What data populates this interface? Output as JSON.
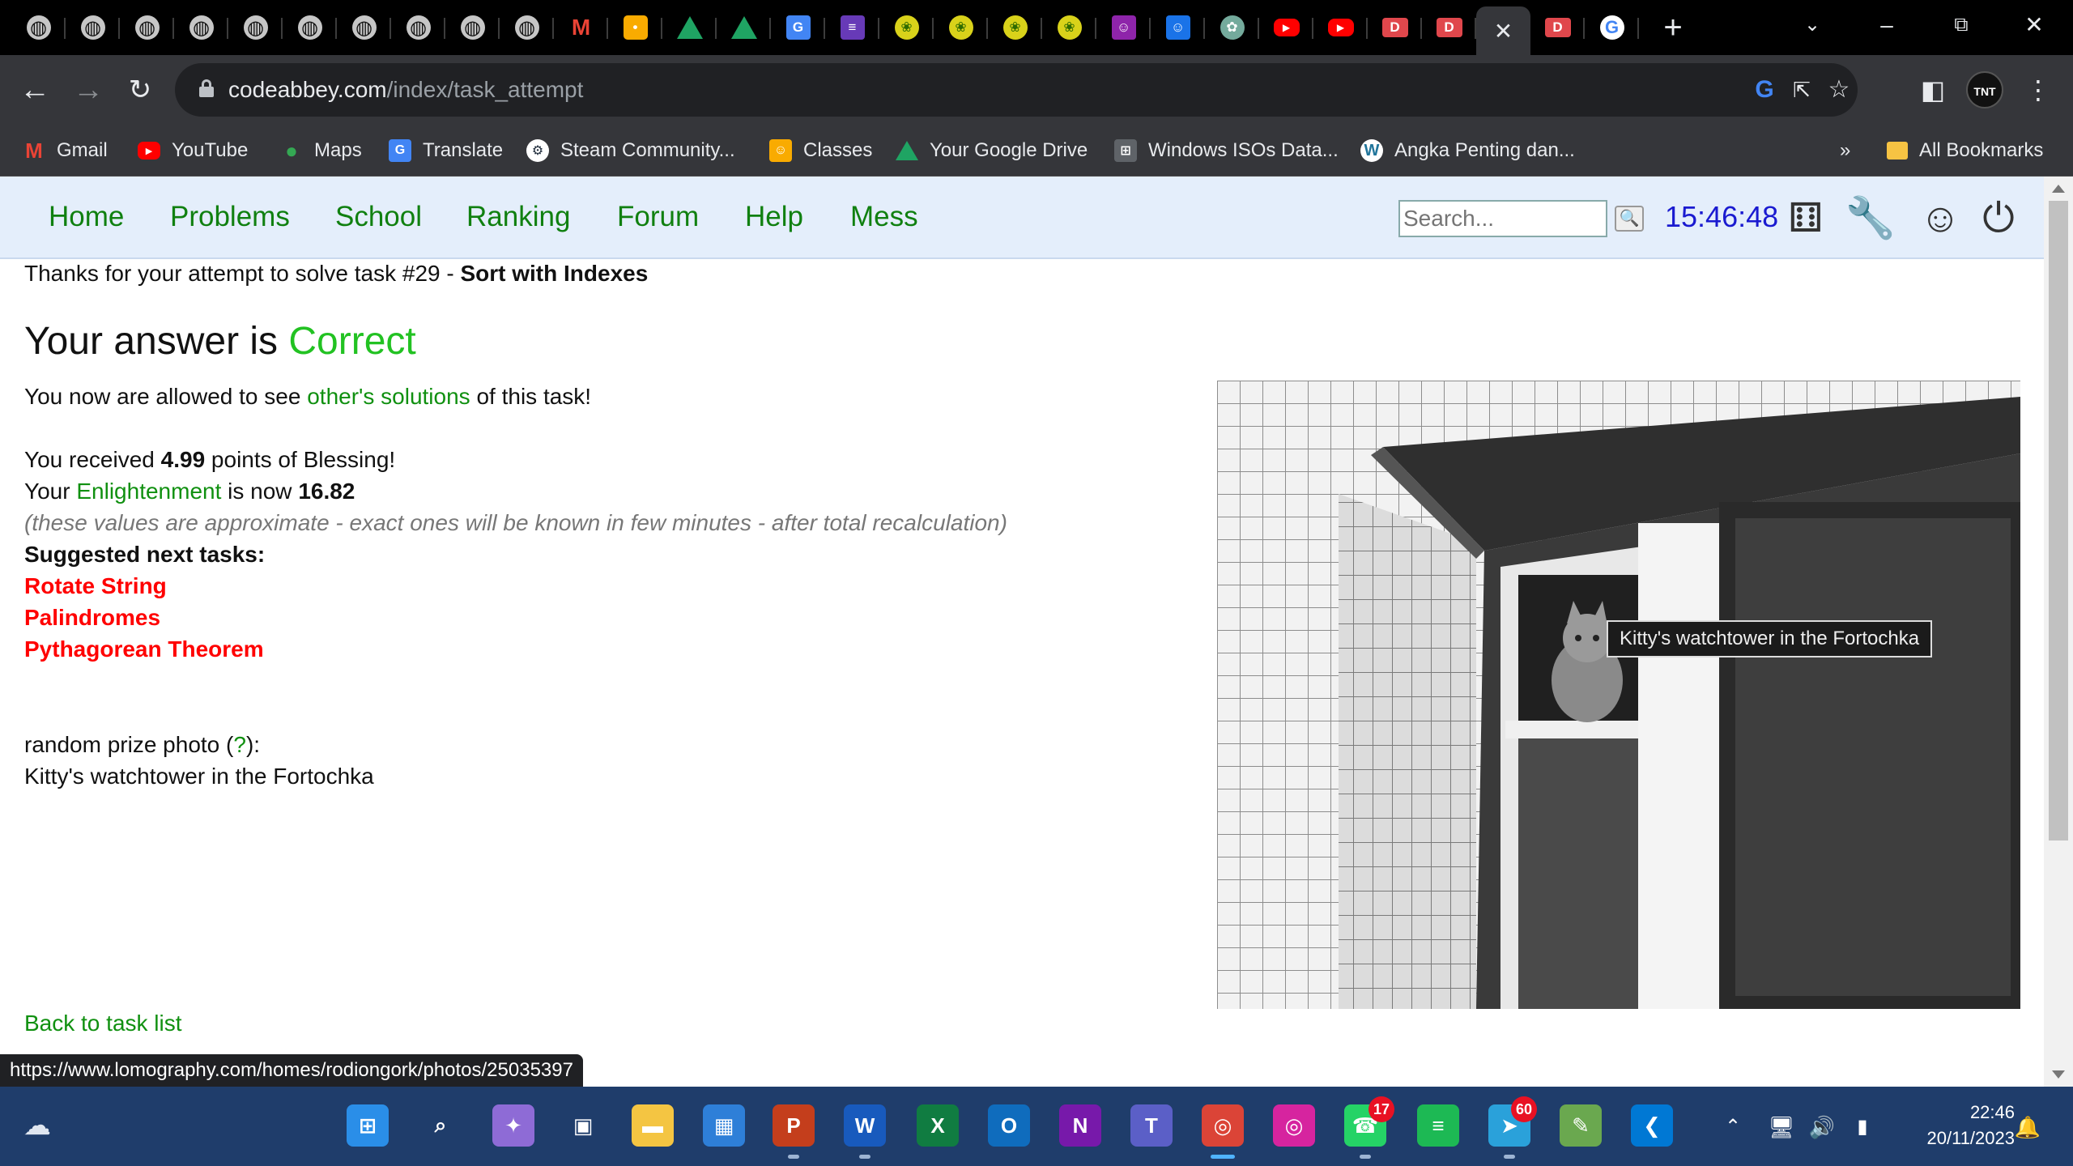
{
  "browser": {
    "tabs": [
      {
        "icon": "globe-icon",
        "glyph": "◍",
        "cls": "globe"
      },
      {
        "icon": "globe-icon",
        "glyph": "◍",
        "cls": "globe"
      },
      {
        "icon": "globe-icon",
        "glyph": "◍",
        "cls": "globe"
      },
      {
        "icon": "globe-icon",
        "glyph": "◍",
        "cls": "globe"
      },
      {
        "icon": "globe-icon",
        "glyph": "◍",
        "cls": "globe"
      },
      {
        "icon": "globe-icon",
        "glyph": "◍",
        "cls": "globe"
      },
      {
        "icon": "globe-icon",
        "glyph": "◍",
        "cls": "globe"
      },
      {
        "icon": "globe-icon",
        "glyph": "◍",
        "cls": "globe"
      },
      {
        "icon": "globe-icon",
        "glyph": "◍",
        "cls": "globe"
      },
      {
        "icon": "globe-icon",
        "glyph": "◍",
        "cls": "globe"
      },
      {
        "icon": "gmail-icon",
        "glyph": "M",
        "cls": "gmail"
      },
      {
        "icon": "google-keep-icon",
        "glyph": "•",
        "cls": "keep"
      },
      {
        "icon": "google-drive-icon",
        "glyph": "",
        "cls": "drive"
      },
      {
        "icon": "google-drive-icon",
        "glyph": "",
        "cls": "drive"
      },
      {
        "icon": "google-translate-icon",
        "glyph": "G",
        "cls": "trans"
      },
      {
        "icon": "google-forms-icon",
        "glyph": "≡",
        "cls": "forms"
      },
      {
        "icon": "school-logo-icon",
        "glyph": "❀",
        "cls": "sch"
      },
      {
        "icon": "school-logo-icon",
        "glyph": "❀",
        "cls": "sch"
      },
      {
        "icon": "school-logo-icon",
        "glyph": "❀",
        "cls": "sch"
      },
      {
        "icon": "school-logo-icon",
        "glyph": "❀",
        "cls": "sch"
      },
      {
        "icon": "google-classroom-icon",
        "glyph": "☺",
        "cls": "class"
      },
      {
        "icon": "google-classroom-icon",
        "glyph": "☺",
        "cls": "classb"
      },
      {
        "icon": "chatgpt-icon",
        "glyph": "✿",
        "cls": "gpt"
      },
      {
        "icon": "youtube-icon",
        "glyph": "▶",
        "cls": "yt"
      },
      {
        "icon": "youtube-icon",
        "glyph": "▶",
        "cls": "yt"
      },
      {
        "icon": "youtube-create-icon",
        "glyph": "D",
        "cls": "ytc"
      },
      {
        "icon": "youtube-create-icon",
        "glyph": "D",
        "cls": "ytc"
      },
      {
        "icon": "close-tab-icon",
        "glyph": "✕",
        "cls": "close",
        "active": true
      },
      {
        "icon": "youtube-create-icon",
        "glyph": "D",
        "cls": "ytc"
      },
      {
        "icon": "google-icon",
        "glyph": "G",
        "cls": "g"
      }
    ],
    "url_host": "codeabbey.com",
    "url_path": "/index/task_attempt",
    "bookmarks": [
      {
        "label": "Gmail",
        "icon": "gmail-icon",
        "glyph": "M",
        "cls": "gm"
      },
      {
        "label": "YouTube",
        "icon": "youtube-icon",
        "glyph": "▶",
        "cls": "ytb"
      },
      {
        "label": "Maps",
        "icon": "maps-pin-icon",
        "glyph": "●",
        "cls": "maps"
      },
      {
        "label": "Translate",
        "icon": "google-translate-icon",
        "glyph": "G",
        "cls": "tr"
      },
      {
        "label": "Steam Community...",
        "icon": "steam-icon",
        "glyph": "⚙",
        "cls": "st"
      },
      {
        "label": "Classes",
        "icon": "google-classroom-icon",
        "glyph": "☺",
        "cls": "cl"
      },
      {
        "label": "Your Google Drive",
        "icon": "google-drive-icon",
        "glyph": "",
        "cls": "dr"
      },
      {
        "label": "Windows ISOs Data...",
        "icon": "windows-icon",
        "glyph": "⊞",
        "cls": "win"
      },
      {
        "label": "Angka Penting dan...",
        "icon": "wordpress-icon",
        "glyph": "W",
        "cls": "wp"
      }
    ],
    "overflow_label": "»",
    "all_bookmarks_label": "All Bookmarks",
    "status_url": "https://www.lomography.com/homes/rodiongork/photos/25035397"
  },
  "site": {
    "nav": [
      "Home",
      "Problems",
      "School",
      "Ranking",
      "Forum",
      "Help",
      "Mess"
    ],
    "search_placeholder": "Search...",
    "clock": "15:46:48"
  },
  "content": {
    "thanks_prefix": "Thanks for your attempt to solve task #29 - ",
    "task_name": "Sort with Indexes",
    "answer_prefix": "Your answer is ",
    "answer_status": "Correct",
    "allowed_prefix": "You now are allowed to see ",
    "solutions_link": "other's solutions",
    "allowed_suffix": " of this task!",
    "received_prefix": "You received ",
    "points": "4.99",
    "received_suffix": " points of Blessing!",
    "enl_prefix": "Your ",
    "enl_link": "Enlightenment",
    "enl_mid": " is now ",
    "enl_value": "16.82",
    "approx_note": "(these values are approximate - exact ones will be known in few minutes - after total recalculation)",
    "suggested_heading": "Suggested next tasks:",
    "suggested": [
      "Rotate String",
      "Palindromes",
      "Pythagorean Theorem"
    ],
    "prize_prefix": "random prize photo (",
    "prize_link": "?",
    "prize_suffix": "):",
    "photo_title": "Kitty's watchtower in the Fortochka",
    "photo_tooltip": "Kitty's watchtower in the Fortochka",
    "back_link": "Back to task list"
  },
  "taskbar": {
    "apps": [
      {
        "name": "windows-start-icon",
        "glyph": "⊞",
        "bg": "#2a8ee8"
      },
      {
        "name": "search-icon",
        "glyph": "⌕",
        "bg": "transparent"
      },
      {
        "name": "copilot-icon",
        "glyph": "✦",
        "bg": "#8e6bd6"
      },
      {
        "name": "task-view-icon",
        "glyph": "▣",
        "bg": "transparent"
      },
      {
        "name": "file-explorer-icon",
        "glyph": "▬",
        "bg": "#f4c542"
      },
      {
        "name": "microsoft-store-icon",
        "glyph": "▦",
        "bg": "#2e7fd8"
      },
      {
        "name": "powerpoint-icon",
        "glyph": "P",
        "bg": "#c43e1c"
      },
      {
        "name": "word-icon",
        "glyph": "W",
        "bg": "#185abd"
      },
      {
        "name": "excel-icon",
        "glyph": "X",
        "bg": "#107c41"
      },
      {
        "name": "outlook-icon",
        "glyph": "O",
        "bg": "#0f6cbd"
      },
      {
        "name": "onenote-icon",
        "glyph": "N",
        "bg": "#7719aa"
      },
      {
        "name": "teams-icon",
        "glyph": "T",
        "bg": "#5b5fc7"
      },
      {
        "name": "chrome-icon",
        "glyph": "◎",
        "bg": "#db4437"
      },
      {
        "name": "instagram-icon",
        "glyph": "◎",
        "bg": "#d6249f"
      },
      {
        "name": "whatsapp-icon",
        "glyph": "☎",
        "bg": "#25d366"
      },
      {
        "name": "spotify-icon",
        "glyph": "≡",
        "bg": "#1db954"
      },
      {
        "name": "telegram-icon",
        "glyph": "➤",
        "bg": "#2aa1da"
      },
      {
        "name": "notepad-icon",
        "glyph": "✎",
        "bg": "#6aa84f"
      },
      {
        "name": "vscode-icon",
        "glyph": "❮",
        "bg": "#0078d4"
      }
    ],
    "whatsapp_badge": "17",
    "telegram_badge": "60",
    "time": "22:46",
    "date": "20/11/2023"
  }
}
